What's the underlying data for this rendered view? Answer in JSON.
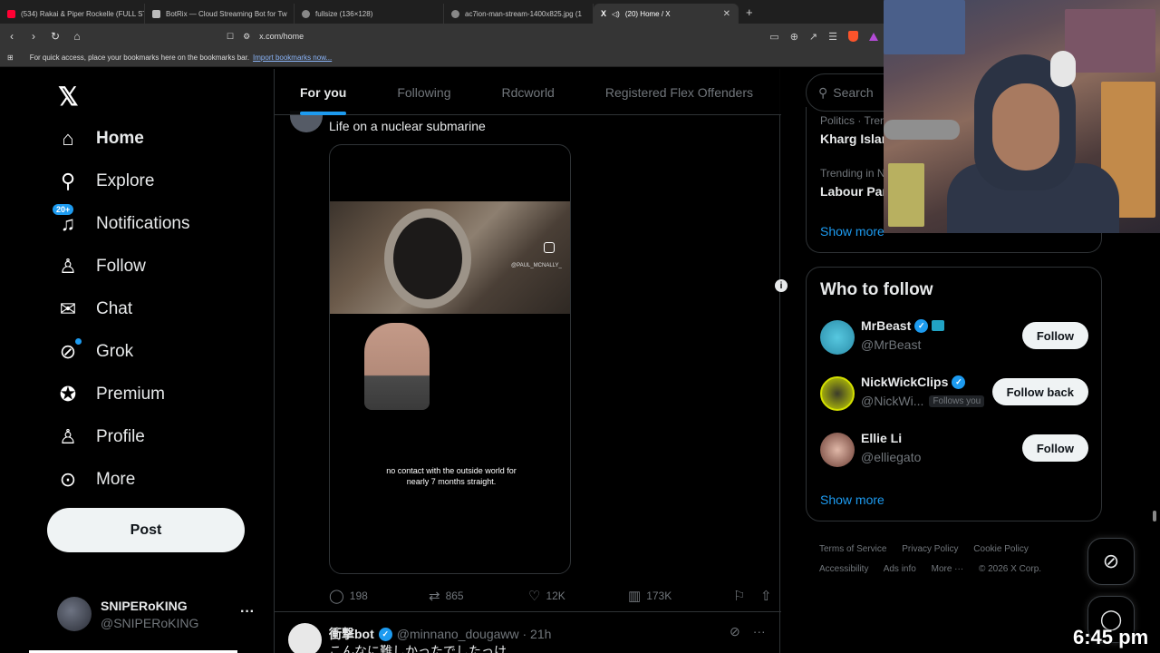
{
  "browser": {
    "tabs": [
      {
        "label": "(534) Rakai & Piper Rockelle (FULL ST",
        "color": "#ff0033",
        "active": false
      },
      {
        "label": "BotRix — Cloud Streaming Bot for Tw",
        "color": "#bbbbbb",
        "active": false
      },
      {
        "label": "fullsize (136×128)",
        "color": "#bbbbbb",
        "active": false
      },
      {
        "label": "ac7ion-man-stream-1400x825.jpg (1",
        "color": "#bbbbbb",
        "active": false
      },
      {
        "label": "(20) Home / X",
        "color": "#ffffff",
        "active": true
      }
    ],
    "close_glyph": "✕",
    "new_tab_glyph": "+",
    "url": "x.com/home",
    "bookmarks_text": "For quick access, place your bookmarks here on the bookmarks bar.",
    "bookmarks_link": "Import bookmarks now..."
  },
  "sidebar": {
    "logo": "𝕏",
    "items": [
      {
        "label": "Home",
        "icon": "home-icon",
        "glyph": "⌂"
      },
      {
        "label": "Explore",
        "icon": "search-icon",
        "glyph": "⚲"
      },
      {
        "label": "Notifications",
        "icon": "bell-icon",
        "glyph": "🔔",
        "badge": "20+"
      },
      {
        "label": "Follow",
        "icon": "add-user-icon",
        "glyph": "👤"
      },
      {
        "label": "Chat",
        "icon": "mail-icon",
        "glyph": "✉"
      },
      {
        "label": "Grok",
        "icon": "grok-icon",
        "glyph": "⊘"
      },
      {
        "label": "Premium",
        "icon": "verified-icon",
        "glyph": "✓"
      },
      {
        "label": "Profile",
        "icon": "profile-icon",
        "glyph": "👤"
      },
      {
        "label": "More",
        "icon": "more-icon",
        "glyph": "⋯"
      }
    ],
    "post_label": "Post",
    "account": {
      "name": "SNIPERoKING",
      "handle": "@SNIPERoKING"
    },
    "more_glyph": "···"
  },
  "timeline": {
    "tabs": [
      "For you",
      "Following",
      "Rdcworld",
      "Registered Flex Offenders"
    ],
    "post1": {
      "text": "Life on a nuclear submarine",
      "media_credit": "@PAUL_MCNALLY_",
      "caption": "no contact with the outside world for nearly 7 months straight.",
      "replies": "198",
      "reposts": "865",
      "likes": "12K",
      "views": "173K"
    },
    "post2": {
      "name": "衝撃bot",
      "handle": "@minnano_dougaww · 21h",
      "body": "こんなに難しかったでしたっけ"
    }
  },
  "right": {
    "search_placeholder": "Search",
    "trends": [
      {
        "meta": "Politics · Trending",
        "title": "Kharg Island"
      },
      {
        "meta": "Trending in N",
        "title": "Labour Par"
      }
    ],
    "trends_show_more": "Show more",
    "who_to_follow": {
      "title": "Who to follow",
      "accounts": [
        {
          "name": "MrBeast",
          "handle": "@MrBeast",
          "button": "Follow",
          "follows_you": ""
        },
        {
          "name": "NickWickClips",
          "handle": "@NickWi...",
          "button": "Follow back",
          "follows_you": "Follows you"
        },
        {
          "name": "Ellie Li",
          "handle": "@elliegato",
          "button": "Follow",
          "follows_you": ""
        }
      ],
      "show_more": "Show more"
    },
    "footer": [
      "Terms of Service",
      "Privacy Policy",
      "Cookie Policy",
      "Accessibility",
      "Ads info",
      "More ···",
      "© 2026 X Corp."
    ]
  },
  "clock": "6:45 pm",
  "colors": {
    "accent": "#1d9bf0",
    "background": "#000000",
    "border": "#2f3336"
  }
}
